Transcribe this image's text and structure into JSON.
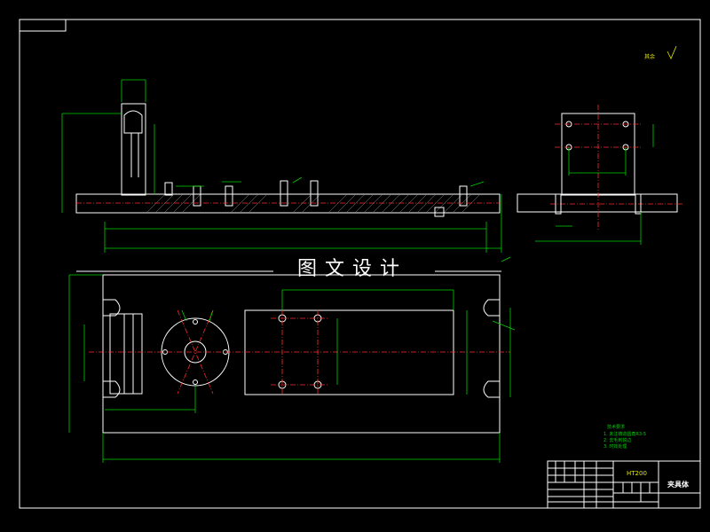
{
  "drawing": {
    "watermark": "图文设计",
    "material": "HT200",
    "part_name": "夹具体",
    "roughness_note": "其余",
    "notes": {
      "title": "技术要求",
      "lines": [
        "1. 未注铸造圆角R3-5",
        "2. 去毛刺锐边",
        "3. 时效处理"
      ]
    }
  },
  "colors": {
    "background": "#000000",
    "outline": "#ffffff",
    "dimension": "#00d000",
    "centerline": "#ff2a2a",
    "annotation": "#e8e800"
  }
}
